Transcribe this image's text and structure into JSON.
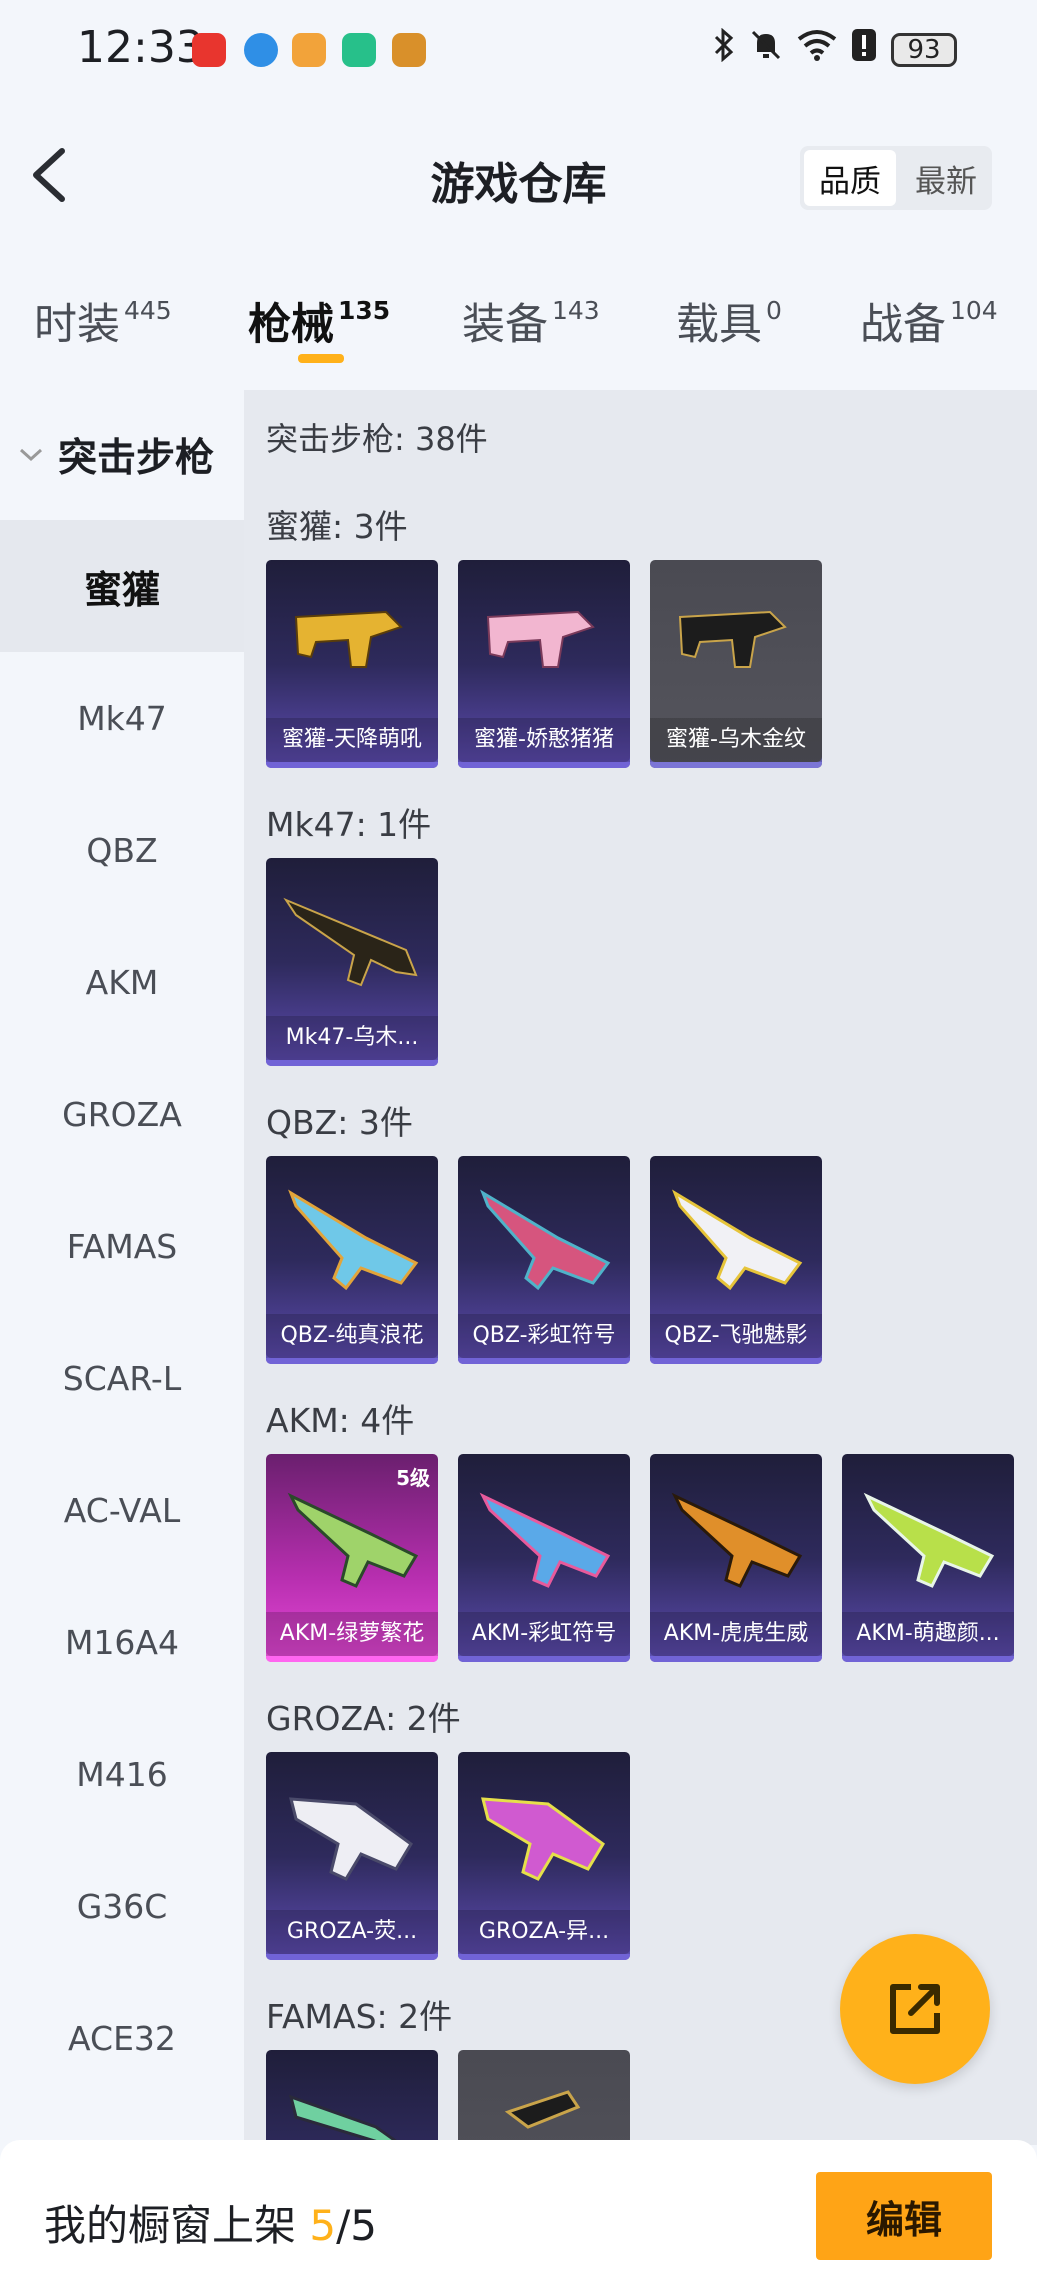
{
  "statusbar": {
    "time": "12:33",
    "battery": "93",
    "notification_icons": [
      "huawei-app-icon",
      "browser-icon",
      "game-icon",
      "shield-app-icon",
      "game-helper-icon"
    ],
    "right_icons": [
      "bluetooth-icon",
      "mute-bell-icon",
      "wifi-icon",
      "alert-icon"
    ]
  },
  "header": {
    "title": "游戏仓库",
    "sort_quality": "品质",
    "sort_latest": "最新"
  },
  "tabs": [
    {
      "label": "时装",
      "count": "445"
    },
    {
      "label": "枪械",
      "count": "135"
    },
    {
      "label": "装备",
      "count": "143"
    },
    {
      "label": "载具",
      "count": "0"
    },
    {
      "label": "战备",
      "count": "104"
    }
  ],
  "sidebar": {
    "group": "突击步枪",
    "items": [
      "蜜獾",
      "Mk47",
      "QBZ",
      "AKM",
      "GROZA",
      "FAMAS",
      "SCAR-L",
      "AC-VAL",
      "M16A4",
      "M416",
      "G36C",
      "ACE32"
    ]
  },
  "content": {
    "total": "突击步枪: 38件",
    "sections": [
      {
        "title": "蜜獾: 3件",
        "items": [
          {
            "label": "蜜獾-天降萌吼"
          },
          {
            "label": "蜜獾-娇憨猪猪"
          },
          {
            "label": "蜜獾-乌木金纹"
          }
        ]
      },
      {
        "title": "Mk47: 1件",
        "items": [
          {
            "label": "Mk47-乌木..."
          }
        ]
      },
      {
        "title": "QBZ: 3件",
        "items": [
          {
            "label": "QBZ-纯真浪花"
          },
          {
            "label": "QBZ-彩虹符号"
          },
          {
            "label": "QBZ-飞驰魅影"
          }
        ]
      },
      {
        "title": "AKM: 4件",
        "items": [
          {
            "label": "AKM-绿萝繁花",
            "badge": "5级"
          },
          {
            "label": "AKM-彩虹符号"
          },
          {
            "label": "AKM-虎虎生威"
          },
          {
            "label": "AKM-萌趣颜..."
          }
        ]
      },
      {
        "title": "GROZA: 2件",
        "items": [
          {
            "label": "GROZA-荧..."
          },
          {
            "label": "GROZA-异..."
          }
        ]
      },
      {
        "title": "FAMAS: 2件",
        "items": []
      }
    ]
  },
  "bottom": {
    "label": "我的橱窗上架 ",
    "current": "5",
    "total": "/5",
    "edit": "编辑"
  },
  "colors": {
    "accent": "#ffb11a",
    "card_purple": "#2e2a5c",
    "card_pink": "#e649d8"
  }
}
